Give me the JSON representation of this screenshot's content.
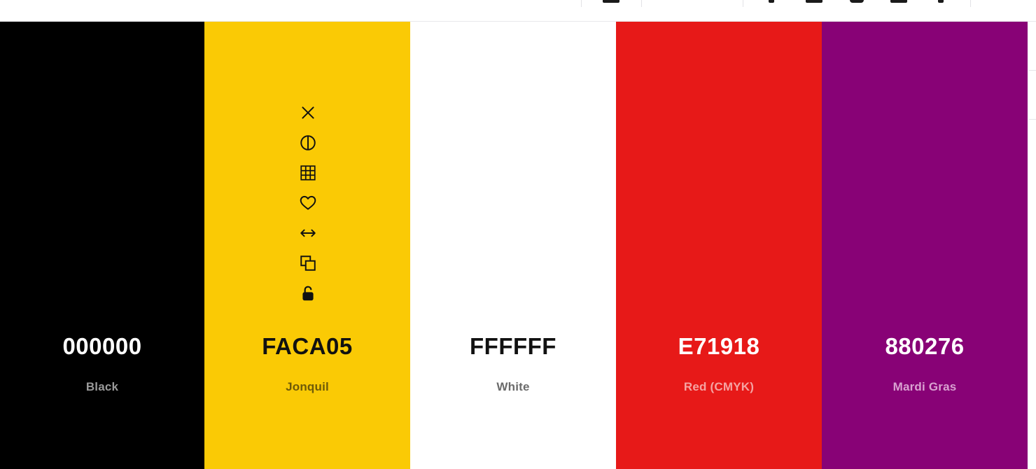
{
  "palette": {
    "colors": [
      {
        "hex": "000000",
        "name": "Black",
        "bg": "#000000",
        "hex_color": "#ffffff",
        "name_color": "#9a9a9a"
      },
      {
        "hex": "FACA05",
        "name": "Jonquil",
        "bg": "#FACA05",
        "hex_color": "#111111",
        "name_color": "#6e5a08"
      },
      {
        "hex": "FFFFFF",
        "name": "White",
        "bg": "#FFFFFF",
        "hex_color": "#111111",
        "name_color": "#6b6b6b"
      },
      {
        "hex": "E71918",
        "name": "Red (CMYK)",
        "bg": "#E71918",
        "hex_color": "#ffffff",
        "name_color": "#f5a3a2"
      },
      {
        "hex": "880276",
        "name": "Mardi Gras",
        "bg": "#880276",
        "hex_color": "#ffffff",
        "name_color": "#d9a1d1"
      }
    ],
    "hover_tools": [
      {
        "icon": "close-icon"
      },
      {
        "icon": "contrast-icon"
      },
      {
        "icon": "shades-grid-icon"
      },
      {
        "icon": "heart-icon"
      },
      {
        "icon": "drag-arrows-icon"
      },
      {
        "icon": "copy-icon"
      },
      {
        "icon": "unlocked-icon"
      }
    ]
  }
}
